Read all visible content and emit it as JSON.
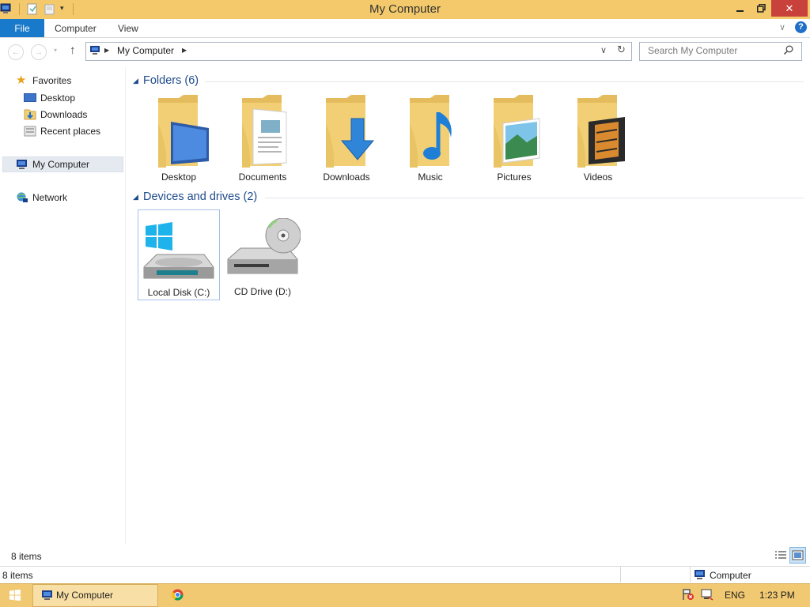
{
  "window": {
    "title": "My Computer"
  },
  "ribbon": {
    "tabs": [
      "File",
      "Computer",
      "View"
    ]
  },
  "address": {
    "location": "My Computer"
  },
  "search": {
    "placeholder": "Search My Computer"
  },
  "sidebar": {
    "favorites_label": "Favorites",
    "items": [
      {
        "label": "Desktop",
        "icon": "desktop-icon"
      },
      {
        "label": "Downloads",
        "icon": "downloads-icon"
      },
      {
        "label": "Recent places",
        "icon": "recent-places-icon"
      }
    ],
    "computer_label": "My Computer",
    "network_label": "Network"
  },
  "folders_group": {
    "heading": "Folders (6)",
    "items": [
      "Desktop",
      "Documents",
      "Downloads",
      "Music",
      "Pictures",
      "Videos"
    ]
  },
  "devices_group": {
    "heading": "Devices and drives (2)",
    "items": [
      "Local Disk (C:)",
      "CD Drive (D:)"
    ]
  },
  "status": {
    "items_top": "8 items",
    "items_bottom": "8 items",
    "location": "Computer"
  },
  "taskbar": {
    "window_label": "My Computer",
    "language": "ENG",
    "time": "1:23 PM"
  },
  "colors": {
    "title_bar": "#f3c96b",
    "file_tab": "#1979ca",
    "taskbar": "#f1c972",
    "group_heading": "#1e4a8c",
    "folder": "#f2cf74"
  }
}
